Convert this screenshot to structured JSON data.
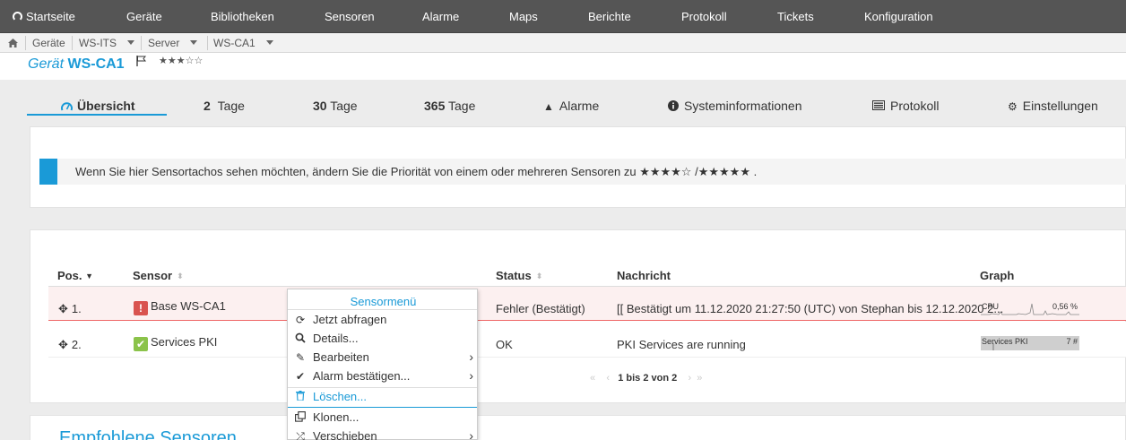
{
  "nav": {
    "items": [
      {
        "label": "Startseite"
      },
      {
        "label": "Geräte"
      },
      {
        "label": "Bibliotheken"
      },
      {
        "label": "Sensoren"
      },
      {
        "label": "Alarme"
      },
      {
        "label": "Maps"
      },
      {
        "label": "Berichte"
      },
      {
        "label": "Protokoll"
      },
      {
        "label": "Tickets"
      },
      {
        "label": "Konfiguration"
      }
    ]
  },
  "breadcrumb": {
    "items": [
      "Geräte",
      "WS-ITS",
      "Server",
      "WS-CA1"
    ]
  },
  "device": {
    "prefix": "Gerät",
    "name": "WS-CA1",
    "priority_stars": "★★★☆☆"
  },
  "tabs": [
    {
      "label": "Übersicht"
    },
    {
      "num": "2",
      "label": "Tage"
    },
    {
      "num": "30",
      "label": "Tage"
    },
    {
      "num": "365",
      "label": "Tage"
    },
    {
      "label": "Alarme"
    },
    {
      "label": "Systeminformationen"
    },
    {
      "label": "Protokoll"
    },
    {
      "label": "Einstellungen"
    }
  ],
  "info": {
    "text": "Wenn Sie hier Sensortachos sehen möchten, ändern Sie die Priorität von einem oder mehreren Sensoren zu",
    "stars_a": "★★★★☆",
    "slash": "/",
    "stars_b": "★★★★★",
    "end": "."
  },
  "table": {
    "columns": {
      "pos": "Pos.",
      "sensor": "Sensor",
      "status": "Status",
      "message": "Nachricht",
      "graph": "Graph"
    },
    "rows": [
      {
        "pos": "1.",
        "sensor": "Base WS-CA1",
        "status": "Fehler (Bestätigt)",
        "message": "[[ Bestätigt um 11.12.2020 21:27:50 (UTC) von Stephan bis 12.12.2020 2...",
        "graph_label": "CPU",
        "graph_value": "0,56 %"
      },
      {
        "pos": "2.",
        "sensor": "Services PKI",
        "status": "OK",
        "message": "PKI Services are running",
        "graph_label": "Services PKI",
        "graph_value": "7 #"
      }
    ],
    "pager": "1 bis 2 von 2"
  },
  "context_menu": {
    "title": "Sensormenü",
    "items": [
      {
        "label": "Jetzt abfragen",
        "icon": "refresh-icon"
      },
      {
        "label": "Details...",
        "icon": "search-icon"
      },
      {
        "label": "Bearbeiten",
        "icon": "edit-icon"
      },
      {
        "label": "Alarm bestätigen...",
        "icon": "check-icon"
      },
      {
        "label": "Löschen...",
        "icon": "trash-icon"
      },
      {
        "label": "Klonen...",
        "icon": "clone-icon"
      },
      {
        "label": "Verschieben",
        "icon": "shuffle-icon"
      }
    ]
  },
  "recommended": {
    "title": "Empfohlene Sensoren"
  },
  "colors": {
    "accent": "#1a9ad7",
    "nav_bg": "#555555",
    "error": "#d9534f",
    "ok": "#8bc34a"
  }
}
